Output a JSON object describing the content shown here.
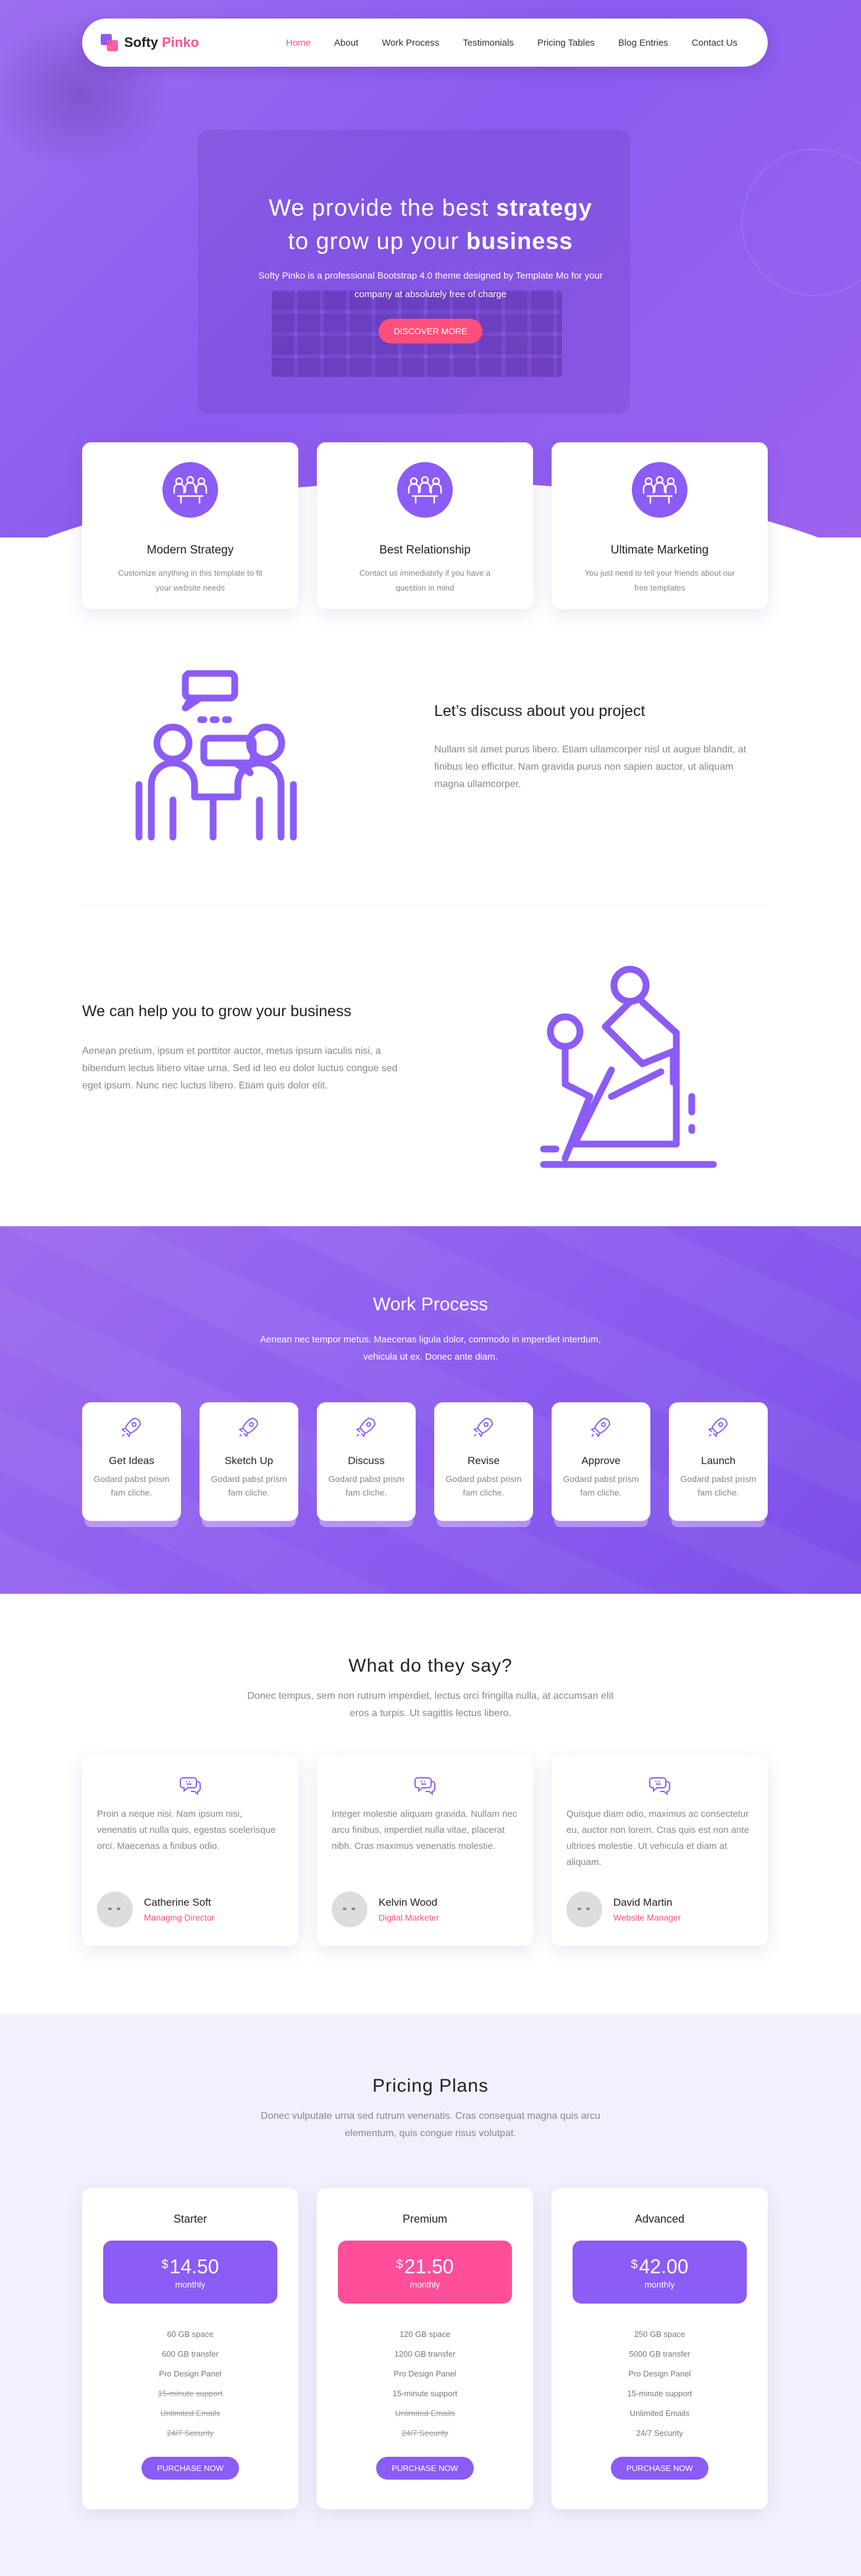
{
  "nav": {
    "logo_a": "Softy ",
    "logo_b": "Pinko",
    "items": [
      "Home",
      "About",
      "Work Process",
      "Testimonials",
      "Pricing Tables",
      "Blog Entries",
      "Contact Us"
    ],
    "active_index": 0
  },
  "hero": {
    "line1_pre": "We provide the best ",
    "line1_bold": "strategy",
    "line2_pre": "to grow up your ",
    "line2_bold": "business",
    "text": "Softy Pinko is a professional Bootstrap 4.0 theme designed by Template Mo for your company at absolutely free of charge",
    "button": "DISCOVER MORE"
  },
  "features": [
    {
      "icon": "team-meeting-icon",
      "title": "Modern Strategy",
      "text": "Customize anything in this template to fit your website needs"
    },
    {
      "icon": "team-meeting-icon",
      "title": "Best Relationship",
      "text": "Contact us immediately if you have a question in mind"
    },
    {
      "icon": "team-meeting-icon",
      "title": "Ultimate Marketing",
      "text": "You just need to tell your friends about our free templates"
    }
  ],
  "about1": {
    "title": "Let’s discuss about you project",
    "text": "Nullam sit amet purus libero. Etiam ullamcorper nisl ut augue blandit, at finibus leo efficitur. Nam gravida purus non sapien auctor, ut aliquam magna ullamcorper."
  },
  "about2": {
    "title": "We can help you to grow your business",
    "text": "Aenean pretium, ipsum et porttitor auctor, metus ipsum iaculis nisi, a bibendum lectus libero vitae urna. Sed id leo eu dolor luctus congue sed eget ipsum. Nunc nec luctus libero. Etiam quis dolor elit."
  },
  "work": {
    "title": "Work Process",
    "text": "Aenean nec tempor metus. Maecenas ligula dolor, commodo in imperdiet interdum, vehicula ut ex. Donec ante diam.",
    "steps": [
      {
        "title": "Get Ideas",
        "text": "Godard pabst prism fam cliche."
      },
      {
        "title": "Sketch Up",
        "text": "Godard pabst prism fam cliche."
      },
      {
        "title": "Discuss",
        "text": "Godard pabst prism fam cliche."
      },
      {
        "title": "Revise",
        "text": "Godard pabst prism fam cliche."
      },
      {
        "title": "Approve",
        "text": "Godard pabst prism fam cliche."
      },
      {
        "title": "Launch",
        "text": "Godard pabst prism fam cliche."
      }
    ]
  },
  "testimonials": {
    "title": "What do they say?",
    "text": "Donec tempus, sem non rutrum imperdiet, lectus orci fringilla nulla, at accumsan elit eros a turpis. Ut sagittis lectus libero.",
    "items": [
      {
        "text": "Proin a neque nisi. Nam ipsum nisi, venenatis ut nulla quis, egestas scelerisque orci. Maecenas a finibus odio.",
        "name": "Catherine Soft",
        "role": "Managing Director"
      },
      {
        "text": "Integer molestie aliquam gravida. Nullam nec arcu finibus, imperdiet nulla vitae, placerat nibh. Cras maximus venenatis molestie.",
        "name": "Kelvin Wood",
        "role": "Digital Marketer"
      },
      {
        "text": "Quisque diam odio, maximus ac consectetur eu, auctor non lorem. Cras quis est non ante ultrices molestie. Ut vehicula et diam at aliquam.",
        "name": "David Martin",
        "role": "Website Manager"
      }
    ]
  },
  "pricing": {
    "title": "Pricing Plans",
    "text": "Donec vulputate urna sed rutrum venenatis. Cras consequat magna quis arcu elementum, quis congue risus volutpat.",
    "plans": [
      {
        "name": "Starter",
        "currency": "$",
        "price": "14.50",
        "period": "monthly",
        "color": "#8b5cf6",
        "features": [
          "60 GB space",
          "600 GB transfer",
          "Pro Design Panel",
          "15-minute support",
          "Unlimited Emails",
          "24/7 Security"
        ],
        "struck": [
          false,
          false,
          false,
          true,
          true,
          true
        ],
        "button": "PURCHASE NOW"
      },
      {
        "name": "Premium",
        "currency": "$",
        "price": "21.50",
        "period": "monthly",
        "color": "#ff4f9a",
        "features": [
          "120 GB space",
          "1200 GB transfer",
          "Pro Design Panel",
          "15-minute support",
          "Unlimited Emails",
          "24/7 Security"
        ],
        "struck": [
          false,
          false,
          false,
          false,
          true,
          true
        ],
        "button": "PURCHASE NOW"
      },
      {
        "name": "Advanced",
        "currency": "$",
        "price": "42.00",
        "period": "monthly",
        "color": "#8b5cf6",
        "features": [
          "250 GB space",
          "5000 GB transfer",
          "Pro Design Panel",
          "15-minute support",
          "Unlimited Emails",
          "24/7 Security"
        ],
        "struck": [
          false,
          false,
          false,
          false,
          false,
          false
        ],
        "button": "PURCHASE NOW"
      }
    ]
  }
}
